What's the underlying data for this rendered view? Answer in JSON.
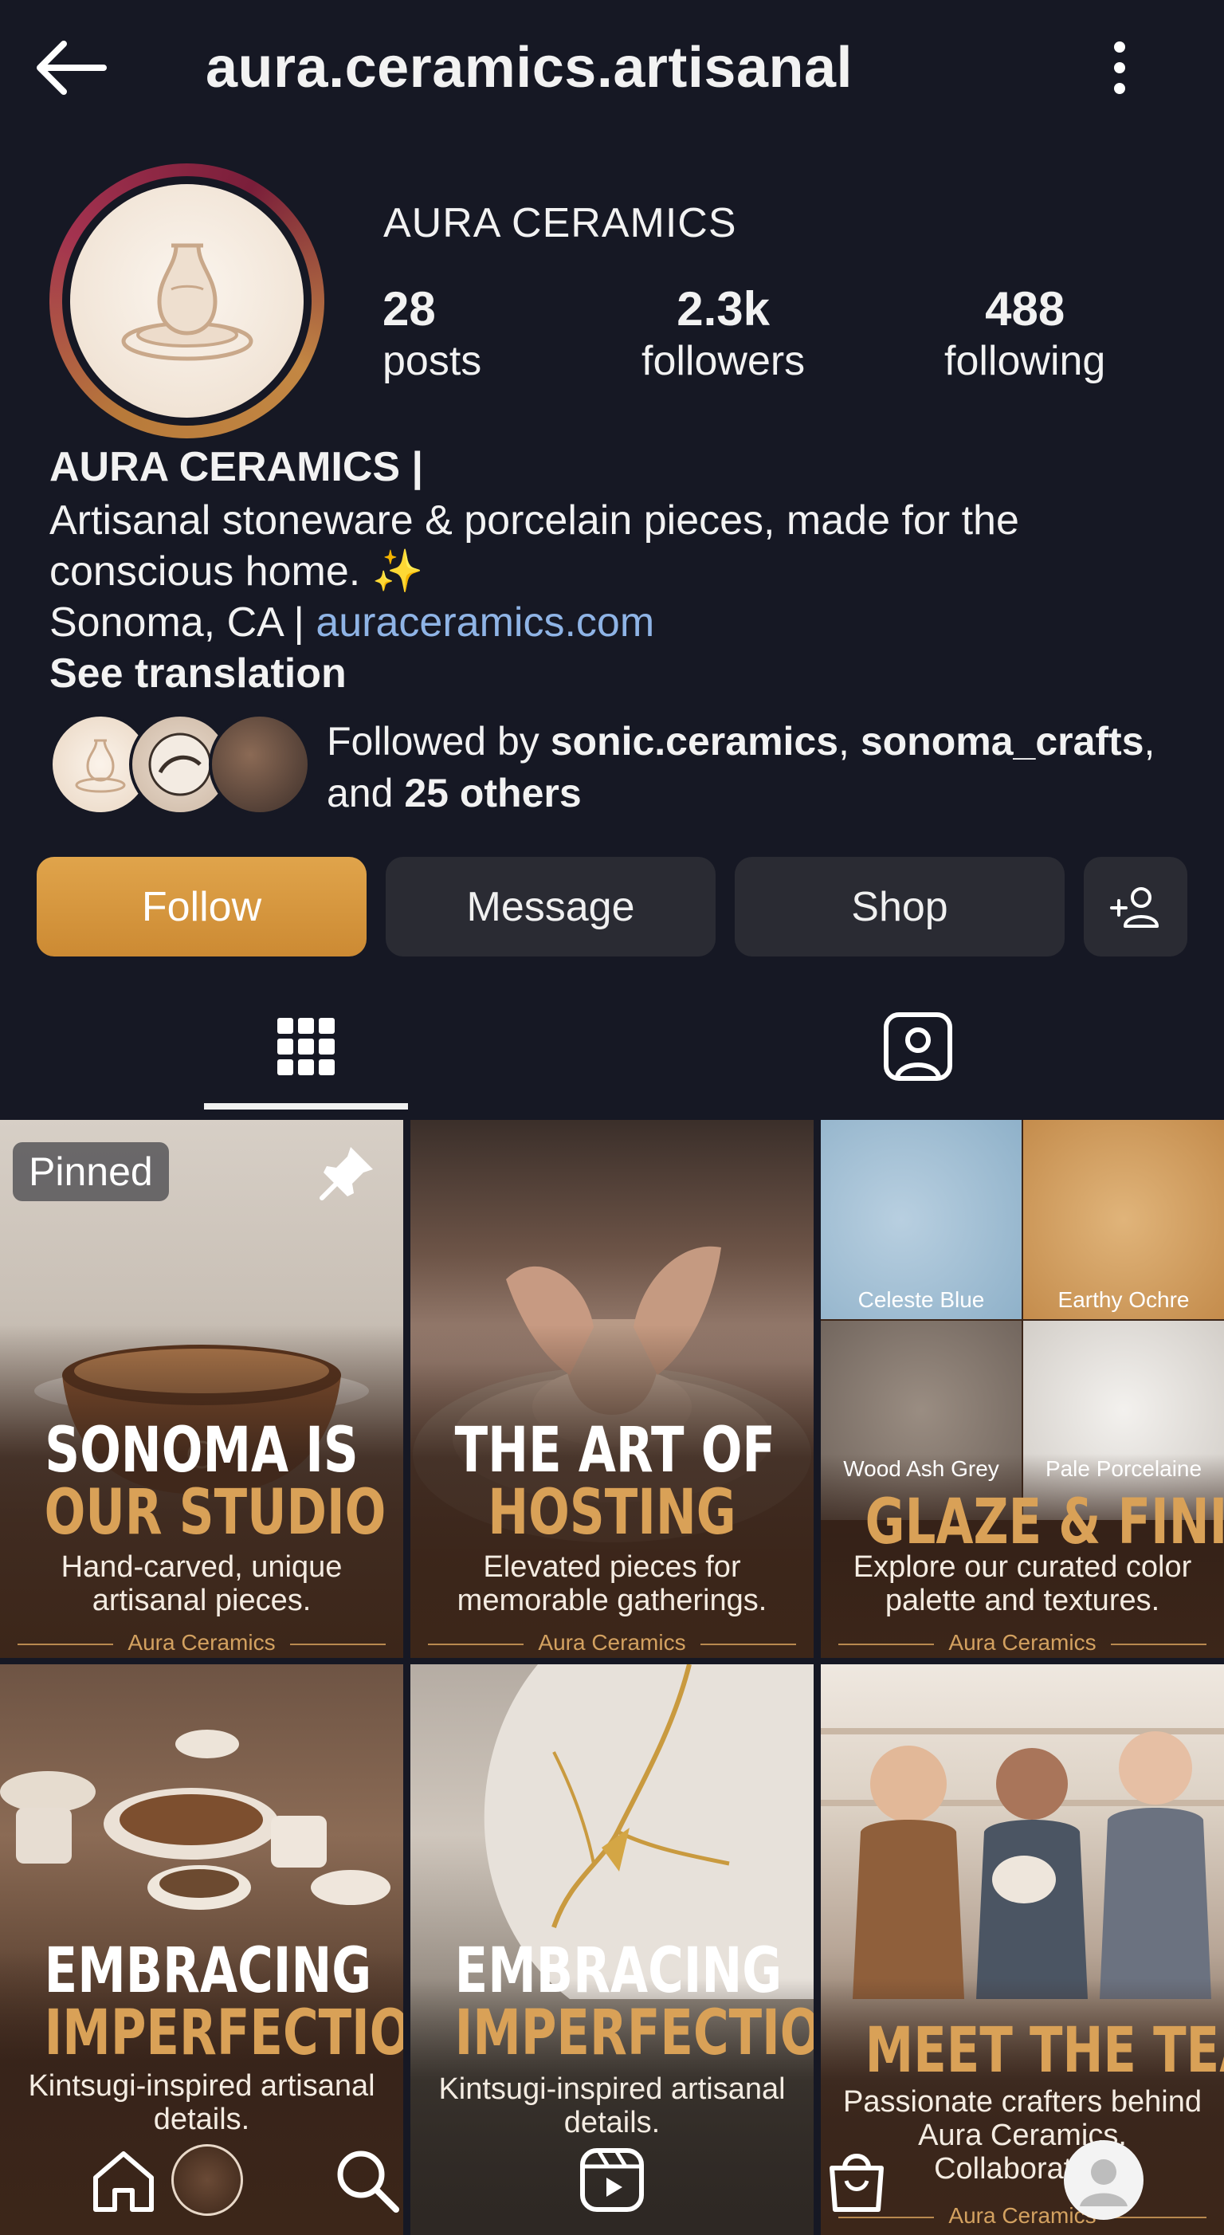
{
  "header": {
    "username": "aura.ceramics.artisanal",
    "back_icon": "arrow-left-icon",
    "more_icon": "more-vertical-icon"
  },
  "profile": {
    "display_name": "AURA CERAMICS",
    "stats": {
      "posts": {
        "value": "28",
        "label": "posts"
      },
      "followers": {
        "value": "2.3k",
        "label": "followers"
      },
      "following": {
        "value": "488",
        "label": "following"
      }
    },
    "bio": {
      "name": "AURA CERAMICS |",
      "line1": "Artisanal stoneware & porcelain pieces, made for the",
      "line2": "conscious home. ✨",
      "location": "Sonoma, CA | ",
      "website": "auraceramics.com",
      "see_translation": "See translation"
    },
    "followed_by": {
      "prefix": "Followed by ",
      "user1": "sonic.ceramics",
      "sep": ", ",
      "user2": "sonoma_crafts",
      "suffix1": ",",
      "and": "and ",
      "others": "25 others"
    }
  },
  "actions": {
    "follow": "Follow",
    "message": "Message",
    "shop": "Shop",
    "add_user_icon": "add-user-icon"
  },
  "tabs": {
    "grid_icon": "grid-icon",
    "tagged_icon": "tagged-icon"
  },
  "posts": [
    {
      "badge": "Pinned",
      "h1": "SONOMA IS",
      "h2": "OUR STUDIO",
      "sub1": "Hand-carved, unique",
      "sub2": "artisanal pieces.",
      "brand": "Aura Ceramics"
    },
    {
      "h1": "THE ART OF",
      "h2": "HOSTING",
      "sub1": "Elevated pieces for",
      "sub2": "memorable gatherings.",
      "brand": "Aura Ceramics"
    },
    {
      "swatches": [
        "Celeste Blue",
        "Earthy Ochre",
        "Wood Ash Grey",
        "Pale Porcelaine"
      ],
      "h2": "GLAZE & FINISHES",
      "sub1": "Explore our curated color",
      "sub2": "palette and textures.",
      "brand": "Aura Ceramics"
    },
    {
      "h1": "EMBRACING",
      "h2": "IMPERFECTION",
      "sub1": "Kintsugi-inspired artisanal",
      "sub2": "details."
    },
    {
      "h1": "EMBRACING",
      "h2": "IMPERFECTION",
      "sub1": "Kintsugi-inspired artisanal",
      "sub2": "details."
    },
    {
      "h2": "MEET THE TEAM",
      "sub1": "Passionate crafters behind",
      "sub2": "Aura Ceramics.",
      "sub3": "Collaborative",
      "brand": "Aura Ceramics"
    }
  ],
  "bottom_nav": [
    "home-icon",
    "avatar",
    "search-icon",
    "reels-icon",
    "shop-bag-icon",
    "profile-icon"
  ],
  "colors": {
    "background": "#161824",
    "accent": "#d9a157",
    "follow_button": "#d99a42",
    "link": "#8fb4e6"
  }
}
